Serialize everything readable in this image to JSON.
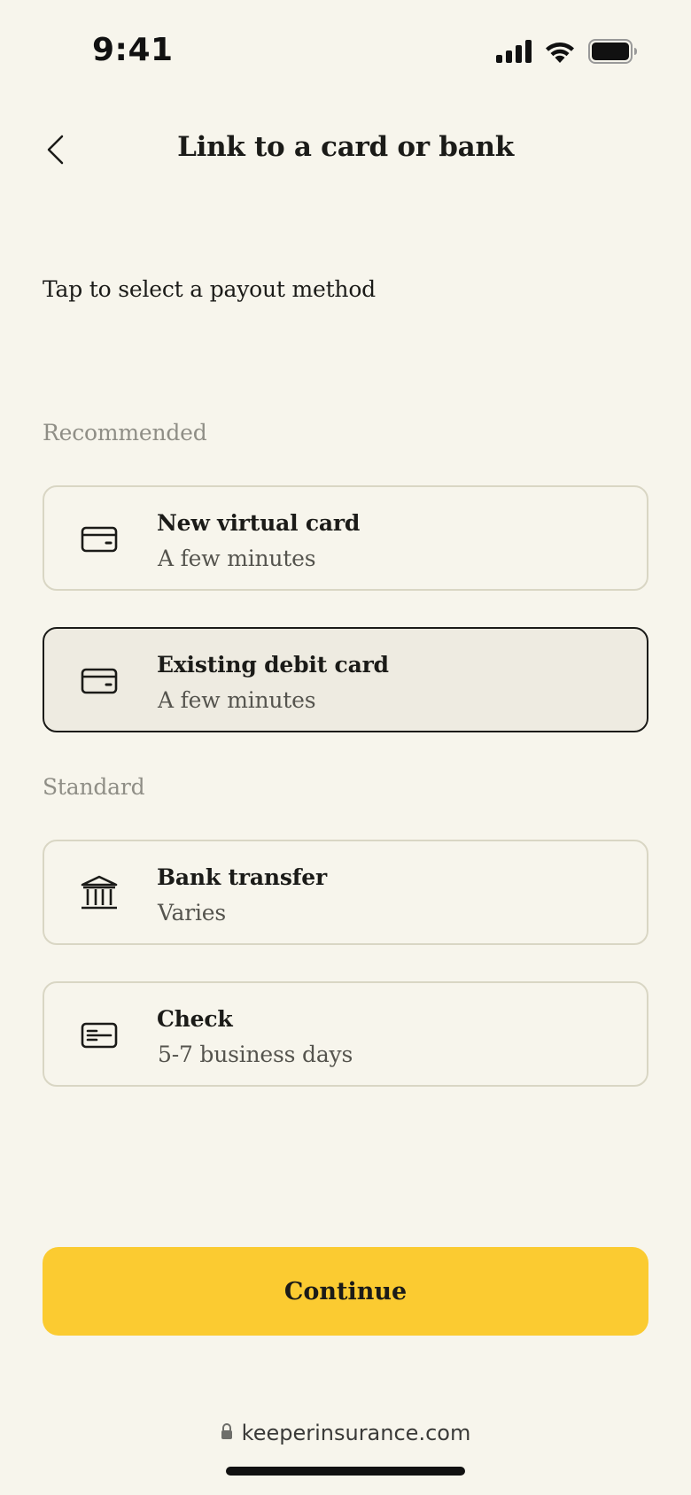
{
  "status_bar": {
    "time": "9:41"
  },
  "header": {
    "title": "Link to a card or bank"
  },
  "instruction": "Tap to select a payout method",
  "sections": {
    "recommended": "Recommended",
    "standard": "Standard"
  },
  "options": [
    {
      "title": "New virtual card",
      "subtitle": "A few minutes",
      "icon": "card-icon",
      "selected": false
    },
    {
      "title": "Existing debit card",
      "subtitle": "A few minutes",
      "icon": "card-icon",
      "selected": true
    },
    {
      "title": "Bank transfer",
      "subtitle": "Varies",
      "icon": "bank-icon",
      "selected": false
    },
    {
      "title": "Check",
      "subtitle": "5-7 business days",
      "icon": "check-icon",
      "selected": false
    }
  ],
  "continue_label": "Continue",
  "browser": {
    "url": "keeperinsurance.com"
  },
  "colors": {
    "background": "#F7F5EC",
    "selected_background": "#EEEBE1",
    "accent": "#FBCB31",
    "border": "#D9D6C4"
  }
}
